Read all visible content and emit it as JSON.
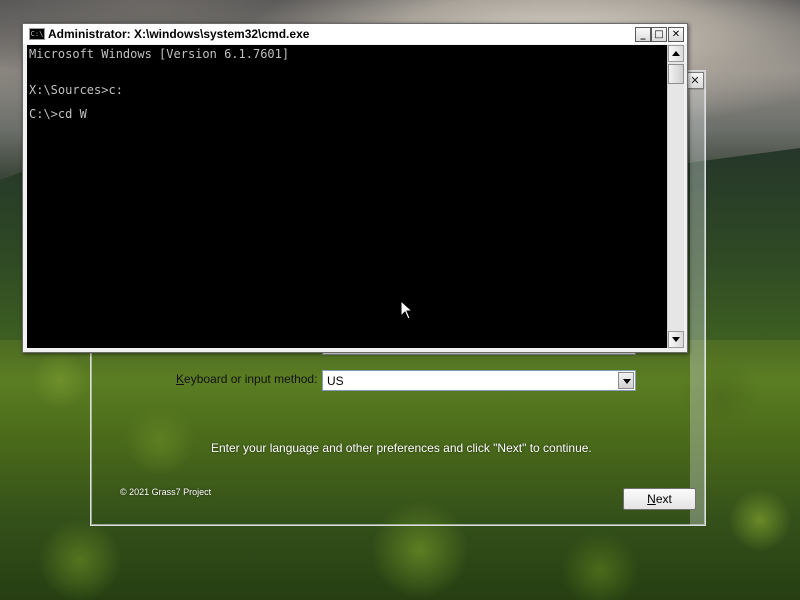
{
  "cmd": {
    "title": "Administrator: X:\\windows\\system32\\cmd.exe",
    "icon": "cmd-app-icon",
    "icon_label": "C:\\",
    "minimize_label": "_",
    "maximize_label": "□",
    "close_label": "✕",
    "lines": [
      "Microsoft Windows [Version 6.1.7601]",
      "X:\\Sources>c:",
      "C:\\>cd W"
    ]
  },
  "setup": {
    "close_label": "✕",
    "keyboard_label_prefix": "",
    "keyboard_label_accel": "K",
    "keyboard_label_rest": "eyboard or input method:",
    "keyboard_value": "US",
    "instruction": "Enter your language and other preferences and click \"Next\" to continue.",
    "copyright": "© 2021 Grass7 Project",
    "next_accel": "N",
    "next_rest": "ext"
  },
  "colors": {
    "console_bg": "#000000",
    "console_text": "#c0c0c0"
  }
}
